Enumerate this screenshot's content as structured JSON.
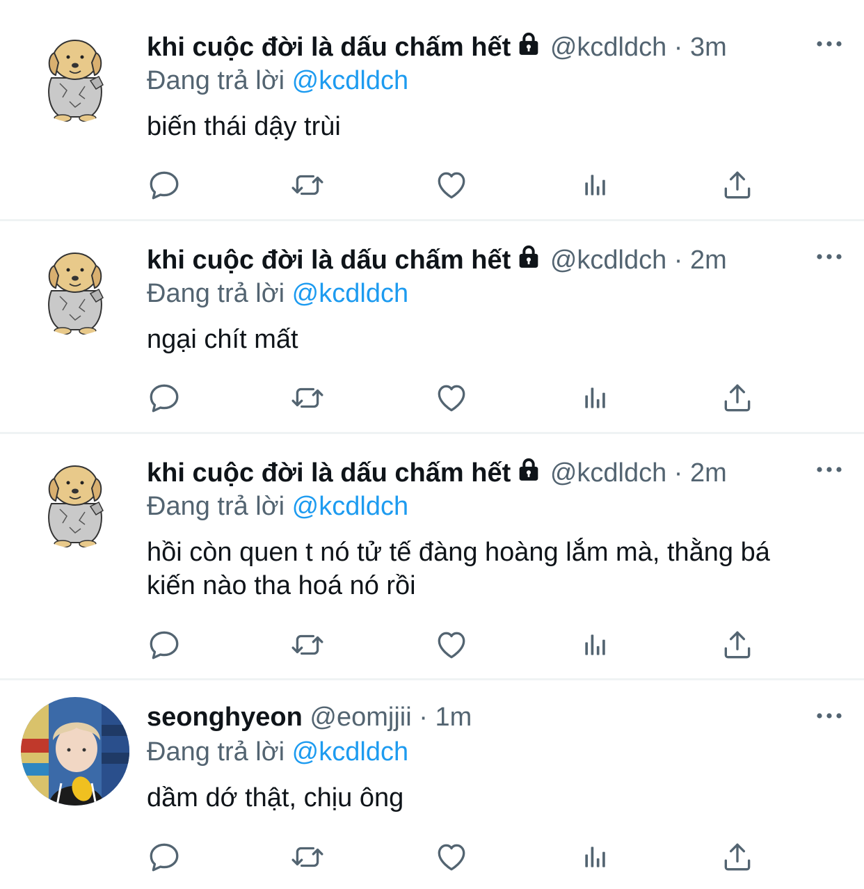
{
  "colors": {
    "accent": "#1d9bf0",
    "muted": "#536471",
    "text": "#0f1419"
  },
  "tweets": [
    {
      "name": "khi cuộc đời là dấu chấm hết",
      "handle": "@kcdldch",
      "dot": "·",
      "time": "3m",
      "reply_prefix": "Đang trả lời",
      "reply_to": "@kcdldch",
      "text": "biến thái dậy trùi",
      "avatar": "dog-avatar",
      "locked": true
    },
    {
      "name": "khi cuộc đời là dấu chấm hết",
      "handle": "@kcdldch",
      "dot": "·",
      "time": "2m",
      "reply_prefix": "Đang trả lời",
      "reply_to": "@kcdldch",
      "text": "ngại chít mất",
      "avatar": "dog-avatar",
      "locked": true
    },
    {
      "name": "khi cuộc đời là dấu chấm hết",
      "handle": "@kcdldch",
      "dot": "·",
      "time": "2m",
      "reply_prefix": "Đang trả lời",
      "reply_to": "@kcdldch",
      "text_line1": "hồi còn quen t nó tử tế đàng hoàng lắm mà, thằng bá",
      "text_line2": "kiến nào tha hoá nó rồi",
      "avatar": "dog-avatar",
      "locked": true
    },
    {
      "name": "seonghyeon",
      "handle": "@eomjjii",
      "dot": "·",
      "time": "1m",
      "reply_prefix": "Đang trả lời",
      "reply_to": "@kcdldch",
      "text": "dầm dớ thật, chịu ông",
      "avatar": "photo-avatar",
      "locked": false
    }
  ],
  "action_icons": [
    "reply-icon",
    "retweet-icon",
    "like-icon",
    "analytics-icon",
    "share-icon"
  ]
}
